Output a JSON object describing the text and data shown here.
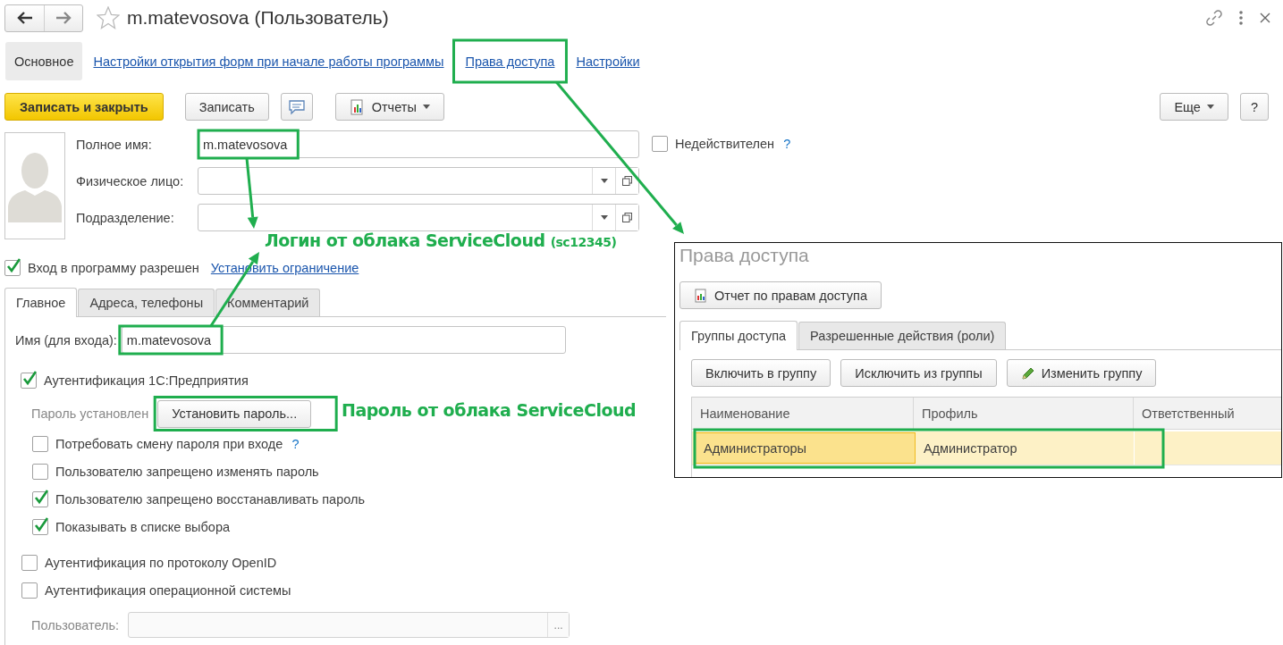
{
  "window": {
    "title": "m.matevosova (Пользователь)",
    "favorite": false
  },
  "nav_links": [
    {
      "label": "Основное",
      "selected": true
    },
    {
      "label": "Настройки открытия форм при начале работы программы",
      "selected": false
    },
    {
      "label": "Права доступа",
      "selected": false
    },
    {
      "label": "Настройки",
      "selected": false
    }
  ],
  "toolbar": {
    "buttons": [
      {
        "label": "Записать и закрыть",
        "kind": "primary"
      },
      {
        "label": "Записать",
        "kind": "plain"
      },
      {
        "kind": "comment"
      },
      {
        "label": "Отчеты",
        "kind": "report-dropdown"
      }
    ],
    "right_buttons": [
      {
        "label": "Еще",
        "kind": "dropdown"
      },
      {
        "label": "?",
        "kind": "plain"
      }
    ]
  },
  "fields": [
    {
      "label": "Полное имя:",
      "value": "m.matevosova",
      "kind": "text"
    },
    {
      "label": "Физическое лицо:",
      "kind": "select"
    },
    {
      "label": "Подразделение:",
      "kind": "select"
    }
  ],
  "invalid": {
    "label": "Недействителен",
    "checked": false,
    "help": "?"
  },
  "login_allowed": {
    "label": "Вход в программу разрешен",
    "checked": true,
    "link": "Установить ограничение"
  },
  "tabs": [
    {
      "label": "Главное",
      "selected": true
    },
    {
      "label": "Адреса, телефоны",
      "selected": false
    },
    {
      "label": "Комментарий",
      "selected": false
    }
  ],
  "login_name": {
    "label": "Имя (для входа):",
    "value": "m.matevosova"
  },
  "auth_1c": {
    "label": "Аутентификация 1С:Предприятия",
    "checked": true
  },
  "password": {
    "status": "Пароль установлен",
    "button": "Установить пароль..."
  },
  "password_options": [
    {
      "label": "Потребовать смену пароля при входе",
      "checked": false,
      "help": "?"
    },
    {
      "label": "Пользователю запрещено изменять пароль",
      "checked": false
    },
    {
      "label": "Пользователю запрещено восстанавливать пароль",
      "checked": true
    },
    {
      "label": "Показывать в списке выбора",
      "checked": true
    }
  ],
  "other_auth": [
    {
      "label": "Аутентификация по протоколу OpenID",
      "checked": false
    },
    {
      "label": "Аутентификация операционной системы",
      "checked": false
    }
  ],
  "os_user": {
    "label": "Пользователь:",
    "disabled": true,
    "button": "..."
  },
  "access_panel": {
    "title": "Права доступа",
    "report_button": "Отчет по правам доступа",
    "tabs": [
      {
        "label": "Группы доступа",
        "selected": true
      },
      {
        "label": "Разрешенные действия (роли)",
        "selected": false
      }
    ],
    "buttons": [
      {
        "label": "Включить в группу",
        "kind": "plain"
      },
      {
        "label": "Исключить из группы",
        "kind": "plain"
      },
      {
        "label": "Изменить группу",
        "kind": "edit"
      }
    ],
    "table": {
      "columns": [
        "Наименование",
        "Профиль",
        "Ответственный"
      ],
      "rows": [
        {
          "cells": [
            "Администраторы",
            "Администратор"
          ],
          "selected": true
        }
      ]
    }
  },
  "annotations": {
    "callouts": [
      {
        "text": "Логин от облака ServiceCloud",
        "note": "(sc12345)"
      },
      {
        "text": "Пароль от облака ServiceCloud"
      }
    ]
  }
}
